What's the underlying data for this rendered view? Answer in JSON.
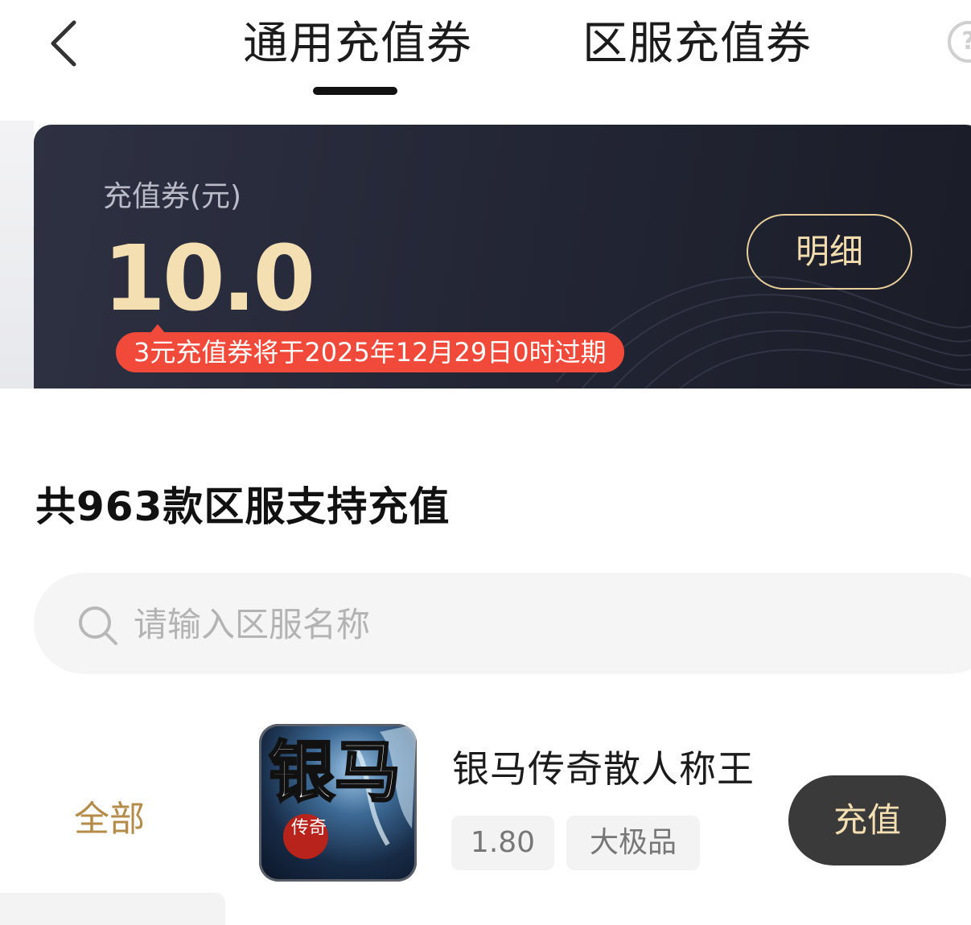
{
  "header": {
    "tabs": [
      {
        "label": "通用充值券",
        "active": true
      },
      {
        "label": "区服充值券",
        "active": false
      }
    ],
    "back_icon": "chevron-left-icon",
    "help_icon": "question-circle-icon",
    "help_glyph": "?"
  },
  "voucher_card": {
    "label": "充值券(元)",
    "amount": "10.0",
    "detail_button": "明细",
    "expire_notice": "3元充值券将于2025年12月29日0时过期"
  },
  "server_list": {
    "count_title": "共963款区服支持充值",
    "search_placeholder": "请输入区服名称",
    "categories": [
      {
        "label": "全部",
        "active": true
      }
    ],
    "games": [
      {
        "name": "银马传奇散人称王",
        "icon_text_main": "银马",
        "icon_text_sub": "传奇",
        "tags": [
          "1.80",
          "大极品"
        ],
        "action": "充值"
      }
    ]
  },
  "colors": {
    "accent_gold": "#b58b4a",
    "card_bg": "#232635",
    "amount_gold": "#f4dfb2",
    "badge_red": "#f1493a"
  }
}
